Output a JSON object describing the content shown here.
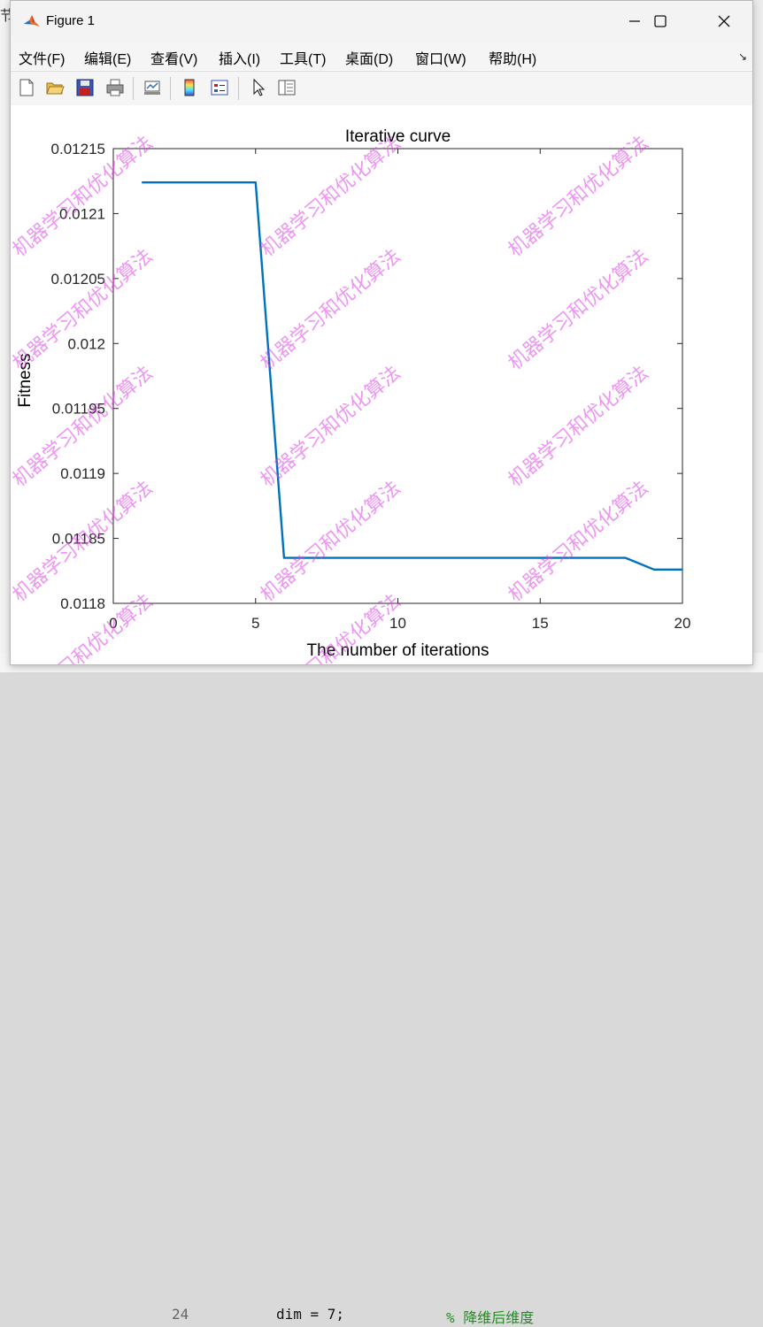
{
  "background": {
    "left_char": "节",
    "code_line_number": "24",
    "code_text": "dim = 7;",
    "code_comment": "% 降维后维度"
  },
  "window": {
    "title": "Figure 1",
    "controls": [
      "minimize",
      "maximize",
      "close"
    ]
  },
  "menu": {
    "items": [
      "文件(F)",
      "编辑(E)",
      "查看(V)",
      "插入(I)",
      "工具(T)",
      "桌面(D)",
      "窗口(W)",
      "帮助(H)"
    ]
  },
  "toolbar": {
    "icons": [
      "new-figure-icon",
      "open-file-icon",
      "save-icon",
      "print-icon",
      "link-icon",
      "colorbar-icon",
      "legend-icon",
      "pointer-icon",
      "property-inspector-icon"
    ]
  },
  "watermark": "机器学习和优化算法",
  "chart_data": {
    "type": "line",
    "title": "Iterative curve",
    "xlabel": "The number of iterations",
    "ylabel": "Fitness",
    "xlim": [
      0,
      20
    ],
    "ylim": [
      0.0118,
      0.01215
    ],
    "xticks": [
      0,
      5,
      10,
      15,
      20
    ],
    "yticks": [
      0.0118,
      0.01185,
      0.0119,
      0.01195,
      0.012,
      0.01205,
      0.0121,
      0.01215
    ],
    "ytick_labels": [
      "0.0118",
      "0.01185",
      "0.0119",
      "0.01195",
      "0.012",
      "0.01205",
      "0.0121",
      "0.01215"
    ],
    "grid": true,
    "line_color": "#0072bd",
    "series": [
      {
        "x": [
          1,
          2,
          3,
          4,
          5,
          6,
          7,
          8,
          9,
          10,
          11,
          12,
          13,
          14,
          15,
          16,
          17,
          18,
          19,
          20
        ],
        "y": [
          0.012124,
          0.012124,
          0.012124,
          0.012124,
          0.012124,
          0.011835,
          0.011835,
          0.011835,
          0.011835,
          0.011835,
          0.011835,
          0.011835,
          0.011835,
          0.011835,
          0.011835,
          0.011835,
          0.011835,
          0.011835,
          0.011826,
          0.011826
        ]
      }
    ]
  }
}
